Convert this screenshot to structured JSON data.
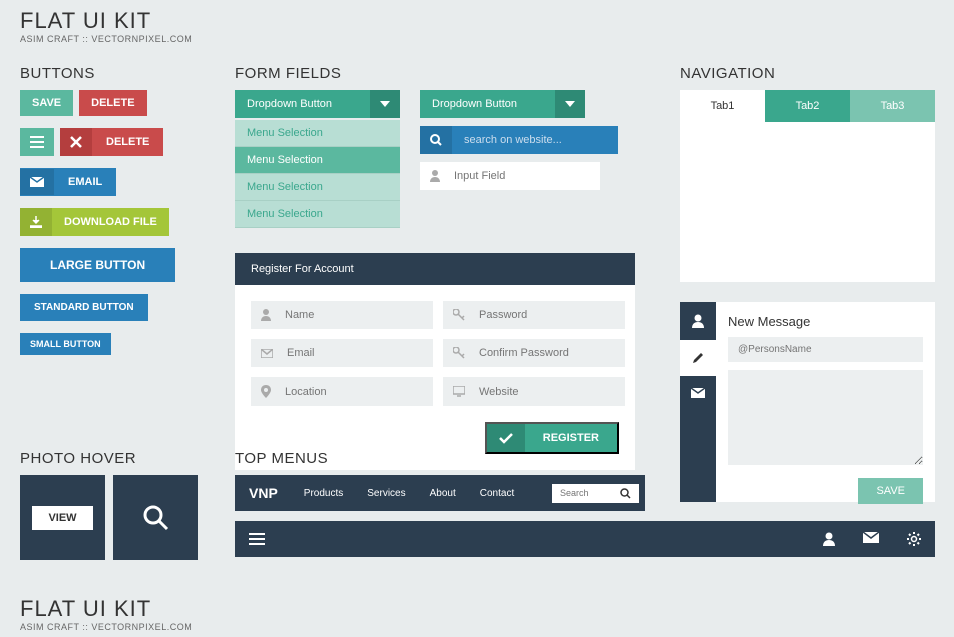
{
  "header": {
    "title": "FLAT UI KIT",
    "subtitle": "ASIM CRAFT  ::  VECTORNPIXEL.COM"
  },
  "sections": {
    "buttons": "BUTTONS",
    "forms": "FORM FIELDS",
    "nav": "NAVIGATION",
    "photo": "PHOTO HOVER",
    "topmenus": "TOP MENUS"
  },
  "buttons": {
    "save": "SAVE",
    "delete": "DELETE",
    "delete2": "DELETE",
    "email": "EMAIL",
    "download": "DOWNLOAD FILE",
    "large": "LARGE BUTTON",
    "standard": "STANDARD BUTTON",
    "small": "SMALL BUTTON"
  },
  "dropdown": {
    "label": "Dropdown Button",
    "items": [
      "Menu Selection",
      "Menu Selection",
      "Menu Selection",
      "Menu Selection"
    ]
  },
  "dropdown2": {
    "label": "Dropdown Button"
  },
  "search": {
    "placeholder": "search on website..."
  },
  "input": {
    "placeholder": "Input Field"
  },
  "form": {
    "title": "Register For Account",
    "name": "Name",
    "email": "Email",
    "location": "Location",
    "password": "Password",
    "confirm": "Confirm Password",
    "website": "Website",
    "register": "REGISTER"
  },
  "tabs": {
    "t1": "Tab1",
    "t2": "Tab2",
    "t3": "Tab3"
  },
  "message": {
    "title": "New Message",
    "placeholder": "@PersonsName",
    "save": "SAVE"
  },
  "photo": {
    "view": "VIEW"
  },
  "menu": {
    "brand": "VNP",
    "products": "Products",
    "services": "Services",
    "about": "About",
    "contact": "Contact",
    "search": "Search"
  }
}
